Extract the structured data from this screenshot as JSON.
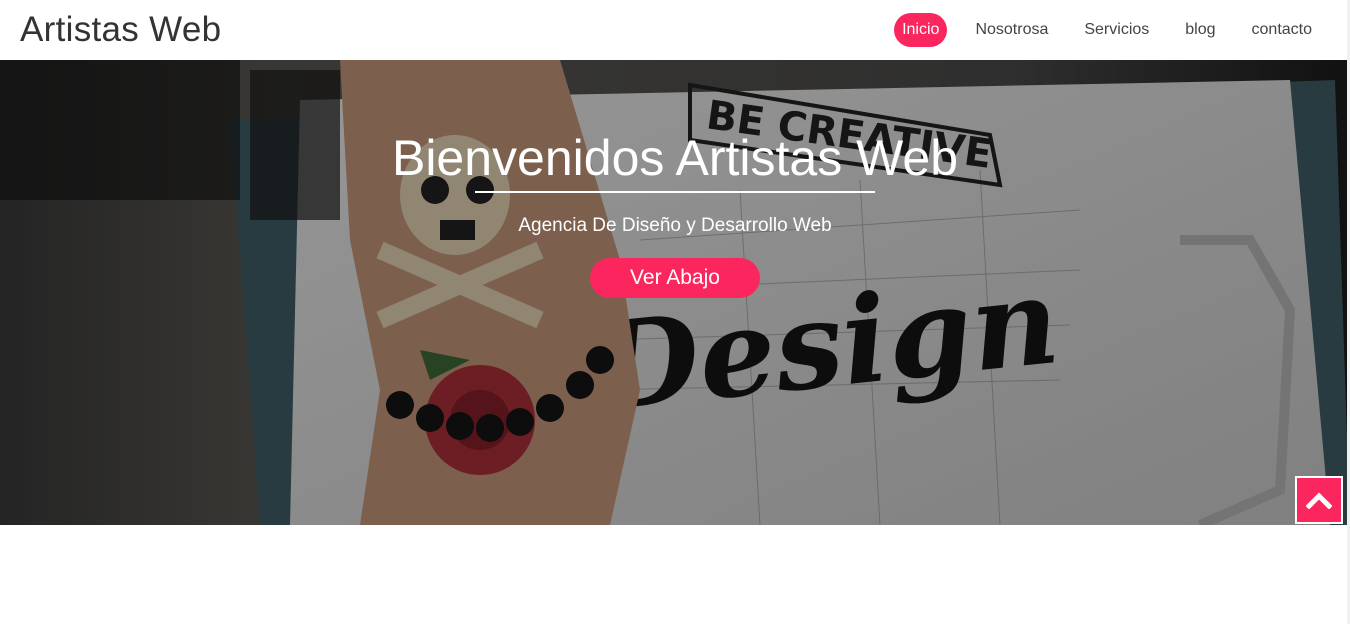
{
  "brand": {
    "name": "Artistas Web"
  },
  "nav": {
    "items": [
      {
        "label": "Inicio",
        "active": true
      },
      {
        "label": "Nosotrosa",
        "active": false
      },
      {
        "label": "Servicios",
        "active": false
      },
      {
        "label": "blog",
        "active": false
      },
      {
        "label": "contacto",
        "active": false
      }
    ]
  },
  "hero": {
    "title": "Bienvenidos Artistas Web",
    "subtitle": "Agencia De Diseño y Desarrollo Web",
    "button_label": "Ver Abajo",
    "background_text_top": "BE CREATIVE",
    "background_text_script": "Design"
  },
  "back_to_top": {
    "icon": "chevron-up-icon"
  },
  "colors": {
    "accent": "#fc265e",
    "text_dark": "#333333",
    "white": "#ffffff"
  }
}
